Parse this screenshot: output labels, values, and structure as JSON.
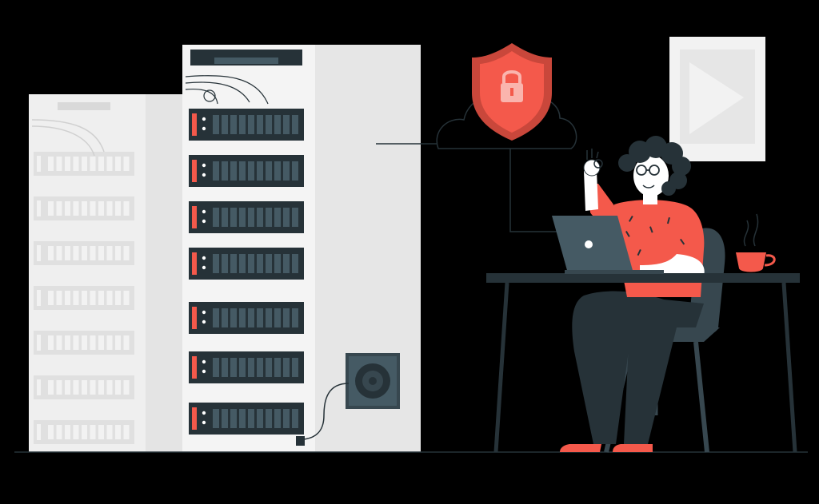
{
  "scene": {
    "background": "#000000",
    "colors": {
      "rack_light": "#F2F2F2",
      "rack_mid": "#E6E6E6",
      "rack_dark": "#D9D9D9",
      "panel": "#263238",
      "accent": "#F4594B",
      "accent_dark": "#C9473B",
      "skin": "#FFFFFF",
      "hair": "#263238",
      "laptop": "#455A64"
    },
    "icons": {
      "shield": "shield-lock-icon",
      "cloud": "cloud-icon",
      "fan": "fan-icon",
      "laptop": "laptop-icon",
      "cup": "coffee-cup-icon"
    }
  }
}
